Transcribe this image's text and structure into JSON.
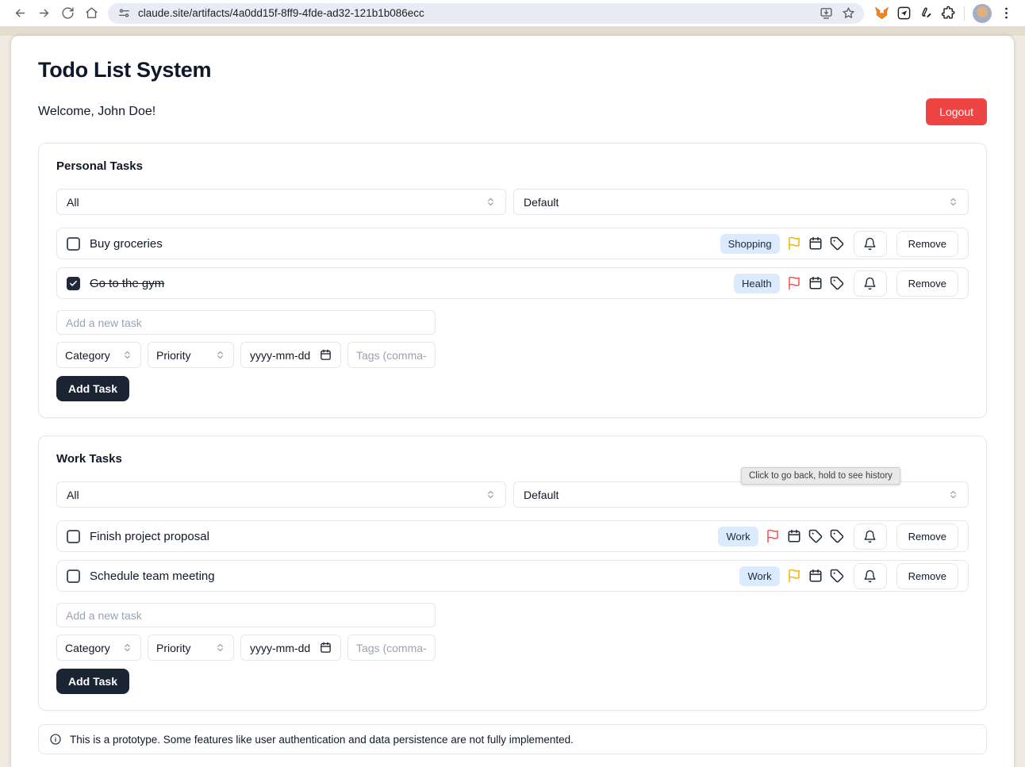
{
  "browser": {
    "url": "claude.site/artifacts/4a0dd15f-8ff9-4fde-ad32-121b1b086ecc",
    "back_tooltip": "Click to go back, hold to see history"
  },
  "page": {
    "title": "Todo List System",
    "welcome": "Welcome, John Doe!",
    "logout_label": "Logout"
  },
  "labels": {
    "remove": "Remove"
  },
  "sections": [
    {
      "title": "Personal Tasks",
      "filter_selected": "All",
      "sort_selected": "Default",
      "tasks": [
        {
          "label": "Buy groceries",
          "completed": false,
          "badge": "Shopping",
          "flag_color": "#f0b408"
        },
        {
          "label": "Go to the gym",
          "completed": true,
          "badge": "Health",
          "flag_color": "#f05252"
        }
      ],
      "new_task_placeholder": "Add a new task",
      "category_placeholder": "Category",
      "priority_placeholder": "Priority",
      "date_placeholder": "yyyy-mm-dd",
      "tags_placeholder": "Tags (comma-separated)",
      "add_button_label": "Add Task"
    },
    {
      "title": "Work Tasks",
      "filter_selected": "All",
      "sort_selected": "Default",
      "tasks": [
        {
          "label": "Finish project proposal",
          "completed": false,
          "badge": "Work",
          "flag_color": "#f05252"
        },
        {
          "label": "Schedule team meeting",
          "completed": false,
          "badge": "Work",
          "flag_color": "#f0b408"
        }
      ],
      "new_task_placeholder": "Add a new task",
      "category_placeholder": "Category",
      "priority_placeholder": "Priority",
      "date_placeholder": "yyyy-mm-dd",
      "tags_placeholder": "Tags (comma-separated)",
      "add_button_label": "Add Task"
    }
  ],
  "footer": {
    "note": "This is a prototype. Some features like user authentication and data persistence are not fully implemented."
  },
  "colors": {
    "logout_red": "#ef4444",
    "badge_bg": "#dbeafe",
    "add_button_dark": "#1b2432",
    "flag_yellow": "#f0b408",
    "flag_red": "#f05252"
  }
}
